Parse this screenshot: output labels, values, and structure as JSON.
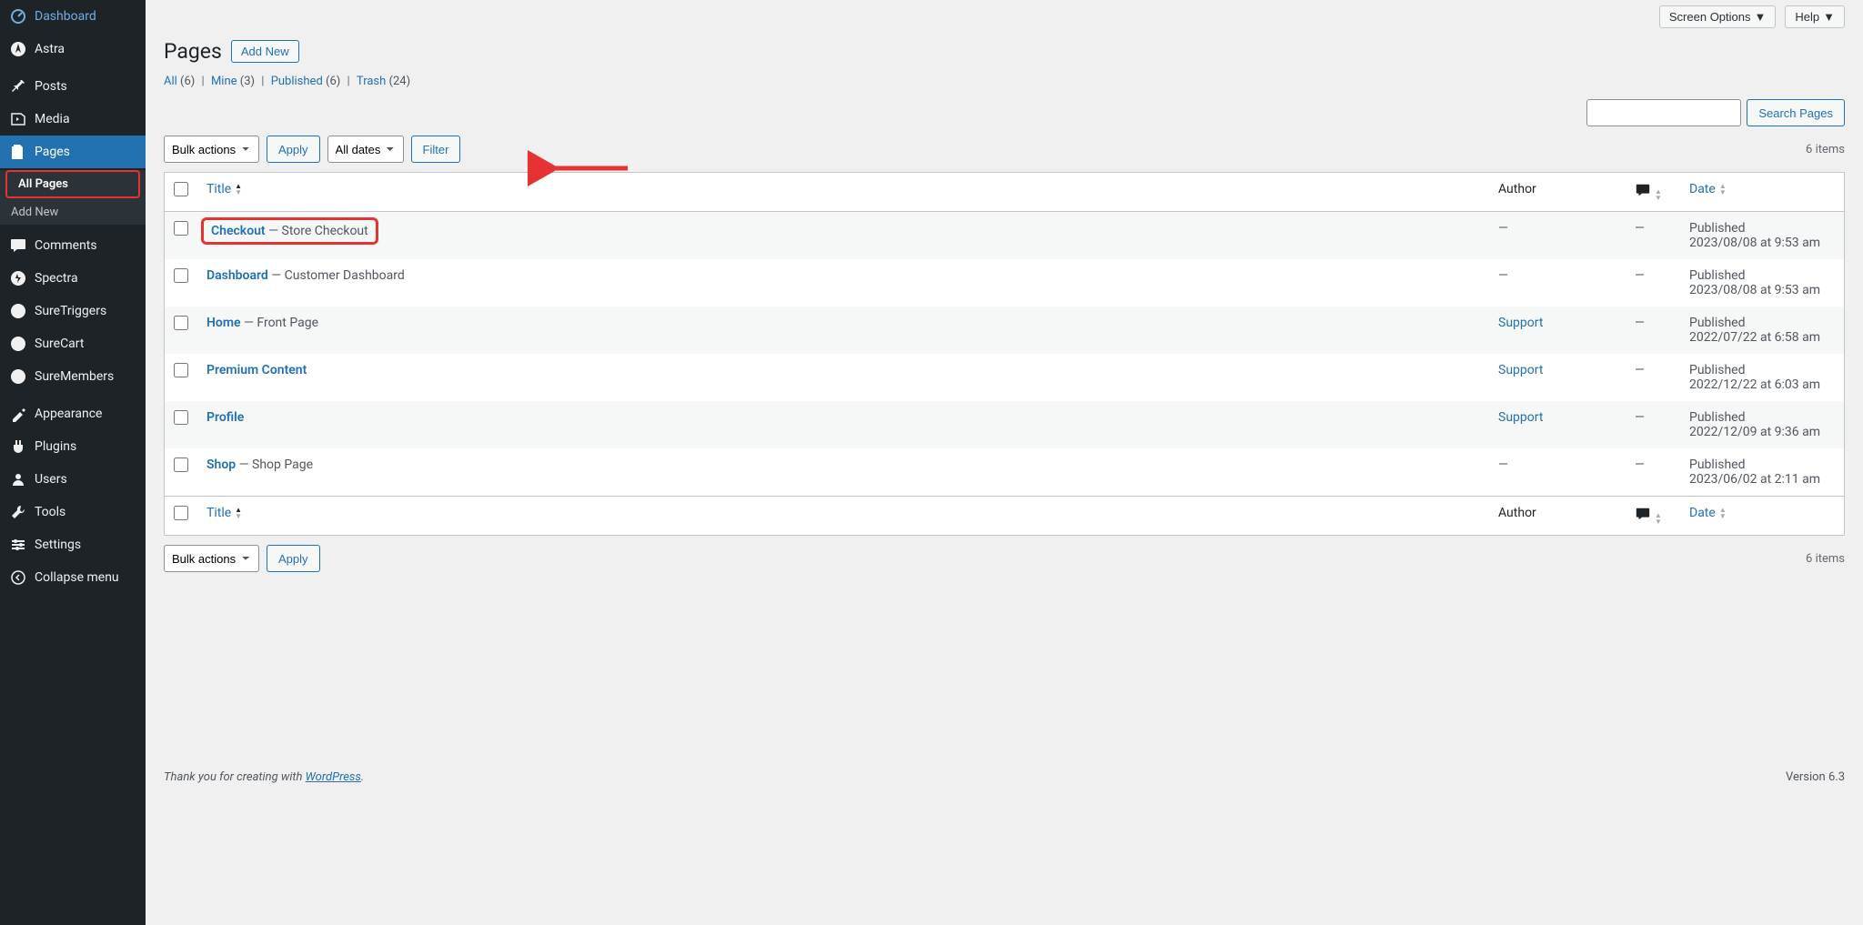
{
  "sidebar": {
    "items": [
      {
        "icon": "dashboard",
        "label": "Dashboard"
      },
      {
        "icon": "astra",
        "label": "Astra"
      },
      {
        "icon": "pin",
        "label": "Posts"
      },
      {
        "icon": "media",
        "label": "Media"
      },
      {
        "icon": "pages",
        "label": "Pages",
        "active": true
      },
      {
        "icon": "comment",
        "label": "Comments"
      },
      {
        "icon": "spectra",
        "label": "Spectra"
      },
      {
        "icon": "suretriggers",
        "label": "SureTriggers"
      },
      {
        "icon": "surecart",
        "label": "SureCart"
      },
      {
        "icon": "suremembers",
        "label": "SureMembers"
      },
      {
        "icon": "appearance",
        "label": "Appearance"
      },
      {
        "icon": "plugins",
        "label": "Plugins"
      },
      {
        "icon": "users",
        "label": "Users"
      },
      {
        "icon": "tools",
        "label": "Tools"
      },
      {
        "icon": "settings",
        "label": "Settings"
      },
      {
        "icon": "collapse",
        "label": "Collapse menu"
      }
    ],
    "submenu": [
      {
        "label": "All Pages",
        "active": true
      },
      {
        "label": "Add New"
      }
    ]
  },
  "topbar": {
    "screen_options": "Screen Options",
    "help": "Help"
  },
  "header": {
    "title": "Pages",
    "add_new": "Add New"
  },
  "subsubsub": [
    {
      "label": "All",
      "count": "(6)"
    },
    {
      "label": "Mine",
      "count": "(3)"
    },
    {
      "label": "Published",
      "count": "(6)"
    },
    {
      "label": "Trash",
      "count": "(24)"
    }
  ],
  "bulk_actions_label": "Bulk actions",
  "apply_label": "Apply",
  "all_dates_label": "All dates",
  "filter_label": "Filter",
  "items_count": "6 items",
  "search_button": "Search Pages",
  "columns": {
    "title": "Title",
    "author": "Author",
    "date": "Date"
  },
  "rows": [
    {
      "title": "Checkout",
      "suffix": " — Store Checkout",
      "author": "—",
      "comments": "—",
      "status": "Published",
      "date": "2023/08/08 at 9:53 am",
      "highlight": true
    },
    {
      "title": "Dashboard",
      "suffix": " — Customer Dashboard",
      "author": "—",
      "comments": "—",
      "status": "Published",
      "date": "2023/08/08 at 9:53 am"
    },
    {
      "title": "Home",
      "suffix": " — Front Page",
      "author": "Support",
      "author_link": true,
      "comments": "—",
      "status": "Published",
      "date": "2022/07/22 at 6:58 am"
    },
    {
      "title": "Premium Content",
      "suffix": "",
      "author": "Support",
      "author_link": true,
      "comments": "—",
      "status": "Published",
      "date": "2022/12/22 at 6:03 am"
    },
    {
      "title": "Profile",
      "suffix": "",
      "author": "Support",
      "author_link": true,
      "comments": "—",
      "status": "Published",
      "date": "2022/12/09 at 9:36 am"
    },
    {
      "title": "Shop",
      "suffix": " — Shop Page",
      "author": "—",
      "comments": "—",
      "status": "Published",
      "date": "2023/06/02 at 2:11 am"
    }
  ],
  "footer": {
    "thanks": "Thank you for creating with ",
    "wp": "WordPress",
    "period": ".",
    "version": "Version 6.3"
  }
}
